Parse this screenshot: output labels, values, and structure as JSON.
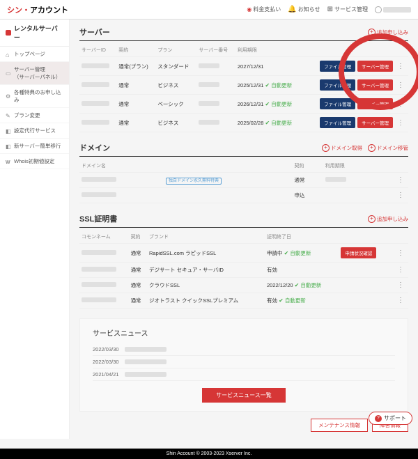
{
  "header": {
    "logo_prefix": "シン・",
    "logo_suffix": "アカウント",
    "fee": "料金支払い",
    "notice": "お知らせ",
    "service": "サービス管理"
  },
  "sidebar": {
    "title": "レンタルサーバー",
    "items": [
      {
        "label": "トップページ"
      },
      {
        "label": "サーバー管理\n（サーバーパネル）"
      },
      {
        "label": "各種特典のお申し込み"
      },
      {
        "label": "プラン変更"
      },
      {
        "label": "設定代行サービス"
      },
      {
        "label": "新サーバー簡単移行"
      },
      {
        "label": "Whois初期値設定"
      }
    ]
  },
  "servers": {
    "title": "サーバー",
    "add": "追加申し込み",
    "cols": {
      "id": "サーバーID",
      "contract": "契約",
      "plan": "プラン",
      "num": "サーバー番号",
      "expire": "利用期限"
    },
    "btn_file": "ファイル管理",
    "btn_panel": "サーバー管理",
    "auto": "自動更新",
    "rows": [
      {
        "contract": "通常(プラン)",
        "plan": "スタンダード",
        "expire": "2027/12/31",
        "auto": false
      },
      {
        "contract": "通常",
        "plan": "ビジネス",
        "expire": "2025/12/31",
        "auto": true
      },
      {
        "contract": "通常",
        "plan": "ベーシック",
        "expire": "2026/12/31",
        "auto": true
      },
      {
        "contract": "通常",
        "plan": "ビジネス",
        "expire": "2025/02/28",
        "auto": true
      }
    ]
  },
  "domains": {
    "title": "ドメイン",
    "get": "ドメイン取得",
    "move": "ドメイン移管",
    "cols": {
      "name": "ドメイン名",
      "contract": "契約",
      "expire": "利用期限"
    },
    "free_badge": "独自ドメイン永久無料特典",
    "rows": [
      {
        "contract": "通常"
      },
      {
        "contract": "申込"
      }
    ]
  },
  "ssl": {
    "title": "SSL証明書",
    "add": "追加申し込み",
    "cols": {
      "cn": "コモンネーム",
      "contract": "契約",
      "brand": "ブランド",
      "expire": "証明終了日"
    },
    "btn_apply": "申請状況確認",
    "auto": "自動更新",
    "rows": [
      {
        "contract": "通常",
        "brand": "RapidSSL.com ラピッドSSL",
        "expire": "申請中",
        "auto": true,
        "btn": true
      },
      {
        "contract": "通常",
        "brand": "デジサート セキュア・サーバID",
        "expire": "有効"
      },
      {
        "contract": "通常",
        "brand": "クラウドSSL",
        "expire": "2022/12/20",
        "auto": true
      },
      {
        "contract": "通常",
        "brand": "ジオトラスト クイックSSLプレミアム",
        "expire": "有効",
        "auto": true
      }
    ]
  },
  "news": {
    "title": "サービスニュース",
    "rows": [
      {
        "date": "2022/03/30"
      },
      {
        "date": "2022/03/30"
      },
      {
        "date": "2021/04/21"
      }
    ],
    "btn": "サービスニュース一覧"
  },
  "footer_links": {
    "maint": "メンテナンス情報",
    "fault": "障害情報"
  },
  "footer": "Shin Account © 2003-2023 Xserver Inc.",
  "support": "サポート"
}
